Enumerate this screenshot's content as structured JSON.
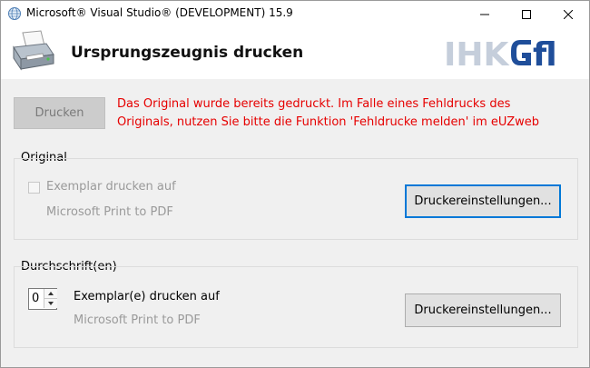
{
  "window": {
    "title": "Microsoft® Visual Studio® (DEVELOPMENT) 15.9",
    "icons": {
      "app": "globe-icon",
      "minimize": "minimize-icon",
      "maximize": "maximize-icon",
      "close": "close-icon"
    }
  },
  "header": {
    "title": "Ursprungszeugnis drucken",
    "icon": "printer-icon",
    "logo_text_left": "IHK",
    "logo_text_right": "fl",
    "logo_colors": {
      "light": "#c5cedb",
      "dark": "#1f4e9a"
    }
  },
  "actions": {
    "print_label": "Drucken",
    "print_disabled": true,
    "warning_line1": "Das Original wurde bereits gedruckt. Im Falle eines Fehldrucks des",
    "warning_line2": "Originals, nutzen Sie bitte die Funktion 'Fehldrucke melden' im eUZweb",
    "warning_color": "#e60000"
  },
  "original": {
    "group_label": "Original",
    "checkbox_label": "Exemplar drucken auf",
    "checkbox_checked": false,
    "printer_name": "Microsoft Print to PDF",
    "settings_label": "Druckereinstellungen..."
  },
  "copies": {
    "group_label": "Durchschrift(en)",
    "count": "0",
    "label": "Exemplar(e) drucken auf",
    "printer_name": "Microsoft Print to PDF",
    "settings_label": "Druckereinstellungen..."
  }
}
